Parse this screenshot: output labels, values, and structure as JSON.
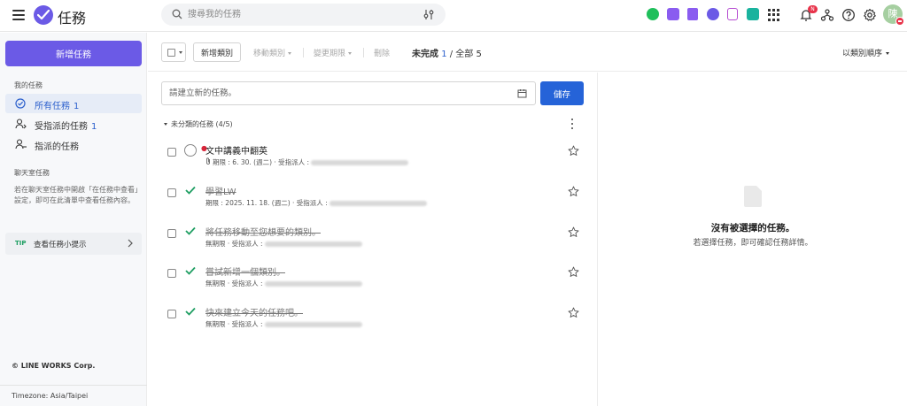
{
  "header": {
    "app_title": "任務",
    "search_placeholder": "搜尋我的任務",
    "notification_badge": "N",
    "avatar_initial": "陳",
    "apps": [
      {
        "name": "line-chat-icon",
        "color": "#1fbf5b"
      },
      {
        "name": "calendar-icon",
        "color": "#8a5cf0"
      },
      {
        "name": "note-icon",
        "color": "#8a5cf0"
      },
      {
        "name": "tasks-icon",
        "color": "#6b5ae6"
      },
      {
        "name": "approval-icon",
        "color": "#b54bd1"
      },
      {
        "name": "contacts-icon",
        "color": "#1ab39e"
      }
    ]
  },
  "sidebar": {
    "new_task_label": "新增任務",
    "my_tasks_label": "我的任務",
    "items": [
      {
        "label": "所有任務",
        "count": "1"
      },
      {
        "label": "受指派的任務",
        "count": "1"
      },
      {
        "label": "指派的任務",
        "count": ""
      }
    ],
    "chat_tasks_label": "聊天室任務",
    "chat_tasks_desc": "若在聊天室任務中開啟「在任務中查看」設定，即可在此清單中查看任務內容。",
    "tip_tag": "TIP",
    "tip_label": "查看任務小提示",
    "copyright": "© LINE WORKS Corp.",
    "timezone": "Timezone: Asia/Taipei"
  },
  "toolbar": {
    "add_category": "新增類別",
    "move_category": "移動類別",
    "change_due": "變更期限",
    "delete": "刪除",
    "incomplete_label": "未完成",
    "incomplete_count": "1",
    "total_label": "/ 全部 5",
    "sort_label": "以類別順序"
  },
  "list": {
    "new_task_placeholder": "請建立新的任務。",
    "save_label": "儲存",
    "group_label": "未分類的任務 (4/5)",
    "tasks": [
      {
        "title": "文中講義中翻英",
        "meta": "期限 : 6. 30. (週二) · 受指派人 :",
        "done": false
      },
      {
        "title": "學習LW",
        "meta": "期限 : 2025. 11. 18. (週二) · 受指派人 :",
        "done": true
      },
      {
        "title": "將任務移動至您想要的類別。",
        "meta": "無期限 · 受指派人 :",
        "done": true
      },
      {
        "title": "嘗試新增一個類別。",
        "meta": "無期限 · 受指派人 :",
        "done": true
      },
      {
        "title": "快來建立今天的任務吧。",
        "meta": "無期限 · 受指派人 :",
        "done": true
      }
    ]
  },
  "detail": {
    "empty_title": "沒有被選擇的任務。",
    "empty_sub": "若選擇任務，即可確認任務詳情。"
  },
  "colors": {
    "brand": "#6b5ae6",
    "primary_button": "#2563d8",
    "check": "#1e9e62",
    "priority": "#d8263b"
  }
}
